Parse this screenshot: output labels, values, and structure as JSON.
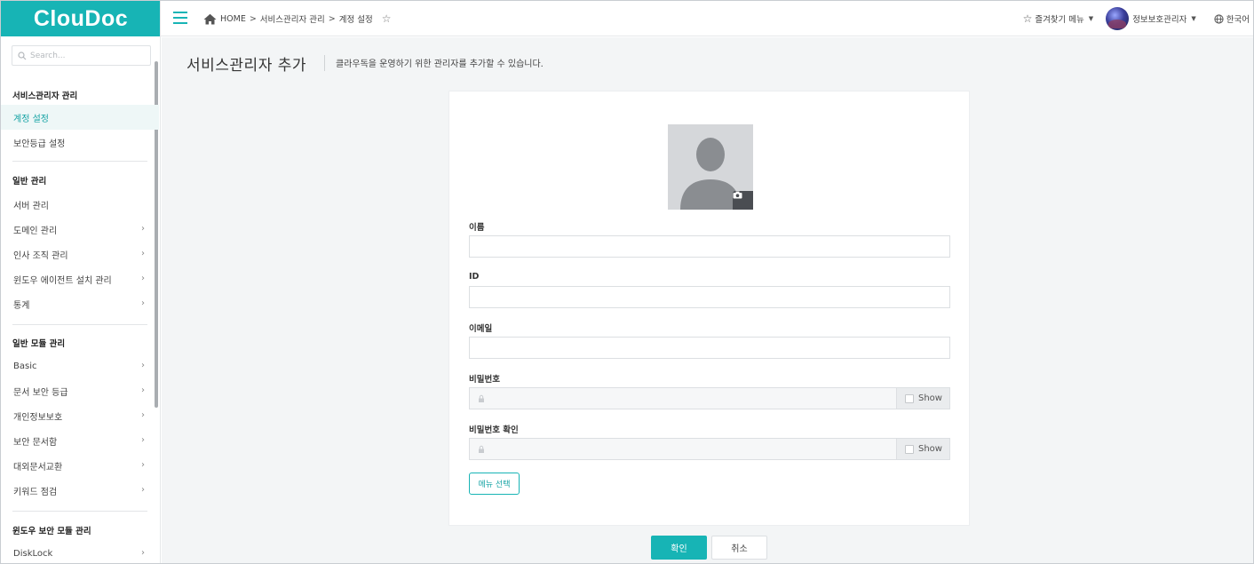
{
  "app": {
    "logo_text": "ClouDoc",
    "brand_color": "#17b4b5"
  },
  "sidebar": {
    "search_placeholder": "Search...",
    "sections": [
      {
        "title": "서비스관리자 관리",
        "items": [
          "계정 설정",
          "보안등급 설정"
        ]
      },
      {
        "title": "일반 관리",
        "items": [
          "서버 관리",
          "도메인 관리",
          "인사 조직 관리",
          "윈도우 에이전트 설치 관리",
          "통계"
        ]
      },
      {
        "title": "일반 모듈 관리",
        "items": [
          "Basic",
          "문서 보안 등급",
          "개인정보보호",
          "보안 문서함",
          "대외문서교환",
          "키워드 점검"
        ]
      },
      {
        "title": "윈도우 보안 모듈 관리",
        "items": [
          "DiskLock"
        ]
      }
    ],
    "active_item": "계정 설정"
  },
  "topbar": {
    "breadcrumb": [
      "HOME",
      "서비스관리자 관리",
      "계정 설정"
    ],
    "favorites_label": "즐겨찾기 메뉴",
    "user_name": "정보보호관리자",
    "language": "한국어"
  },
  "main": {
    "title": "서비스관리자 추가",
    "description": "클라우독을 운영하기 위한 관리자를 추가할 수 있습니다.",
    "form": {
      "name_label": "이름",
      "id_label": "ID",
      "email_label": "이메일",
      "password_label": "비밀번호",
      "password_confirm_label": "비밀번호 확인",
      "show_label": "Show",
      "menu_select_label": "메뉴 선택"
    },
    "confirm_label": "확인",
    "cancel_label": "취소"
  }
}
